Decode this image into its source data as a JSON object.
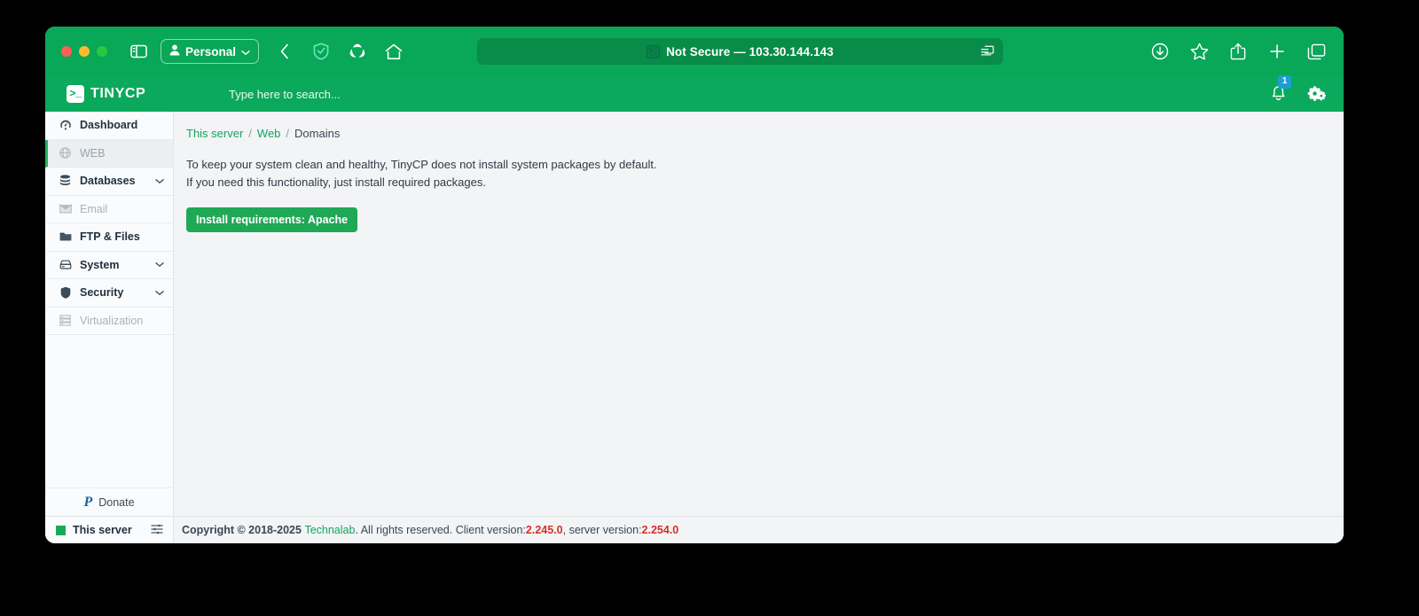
{
  "browser": {
    "traffic_lights": [
      "close",
      "minimize",
      "maximize"
    ],
    "sidebar_toggle_icon": "sidebar-icon",
    "profile": {
      "label": "Personal",
      "icon": "person-icon",
      "chevron": "chevron-down-icon"
    },
    "nav": {
      "back_icon": "back-chevron-icon",
      "shield_icon": "adguard-shield-icon",
      "extension_icon": "extension-icon",
      "home_icon": "home-icon"
    },
    "url_bar": {
      "favicon": ">_",
      "security_text": "Not Secure",
      "separator": "—",
      "address": "103.30.144.143",
      "full_text": "Not Secure — 103.30.144.143",
      "reader_icon": "reader-view-icon"
    },
    "toolbar_right": [
      {
        "name": "downloads-icon",
        "glyph": "download"
      },
      {
        "name": "bookmarks-star-icon",
        "glyph": "star"
      },
      {
        "name": "share-icon",
        "glyph": "share"
      },
      {
        "name": "new-tab-icon",
        "glyph": "plus"
      },
      {
        "name": "tab-overview-icon",
        "glyph": "tabs"
      }
    ]
  },
  "app": {
    "brand": {
      "mark": ">_",
      "name": "TINYCP"
    },
    "search": {
      "value": "",
      "placeholder": "Type here to search..."
    },
    "notifications": {
      "icon": "bell-icon",
      "count": "1",
      "badge_color": "#1b9fd3"
    },
    "settings": {
      "icon": "gears-icon"
    }
  },
  "sidebar": {
    "items": [
      {
        "label": "Dashboard",
        "icon": "dashboard-gauge-icon",
        "state": "normal",
        "expandable": false
      },
      {
        "label": "WEB",
        "icon": "globe-icon",
        "state": "active",
        "expandable": false
      },
      {
        "label": "Databases",
        "icon": "database-icon",
        "state": "normal",
        "expandable": true
      },
      {
        "label": "Email",
        "icon": "envelope-icon",
        "state": "disabled",
        "expandable": false
      },
      {
        "label": "FTP & Files",
        "icon": "folder-icon",
        "state": "normal",
        "expandable": false
      },
      {
        "label": "System",
        "icon": "server-icon",
        "state": "normal",
        "expandable": true
      },
      {
        "label": "Security",
        "icon": "shield-icon",
        "state": "normal",
        "expandable": true
      },
      {
        "label": "Virtualization",
        "icon": "server-stack-icon",
        "state": "disabled",
        "expandable": false
      }
    ],
    "donate": {
      "label": "Donate",
      "icon": "paypal-icon"
    },
    "server": {
      "label": "This server",
      "status_color": "#18a85a",
      "menu_icon": "server-list-icon"
    }
  },
  "main": {
    "breadcrumb": {
      "root": "This server",
      "sep": "/",
      "section": "Web",
      "current": "Domains"
    },
    "notice": {
      "line1": "To keep your system clean and healthy, TinyCP does not install system packages by default.",
      "line2": "If you need this functionality, just install required packages."
    },
    "install_button": "Install requirements: Apache"
  },
  "footer": {
    "copyright": "Copyright © 2018-2025",
    "company": "Technalab",
    "rights": ". All rights reserved. Client version: ",
    "client_version": "2.245.0",
    "server_label": ", server version: ",
    "server_version": "2.254.0"
  },
  "colors": {
    "browser_green": "#09a758",
    "app_green": "#0ba95b",
    "url_field_green": "#088c48",
    "accent_green": "#16a45c",
    "button_green": "#1fa855",
    "version_red": "#d93025",
    "badge_blue": "#1b9fd3"
  }
}
